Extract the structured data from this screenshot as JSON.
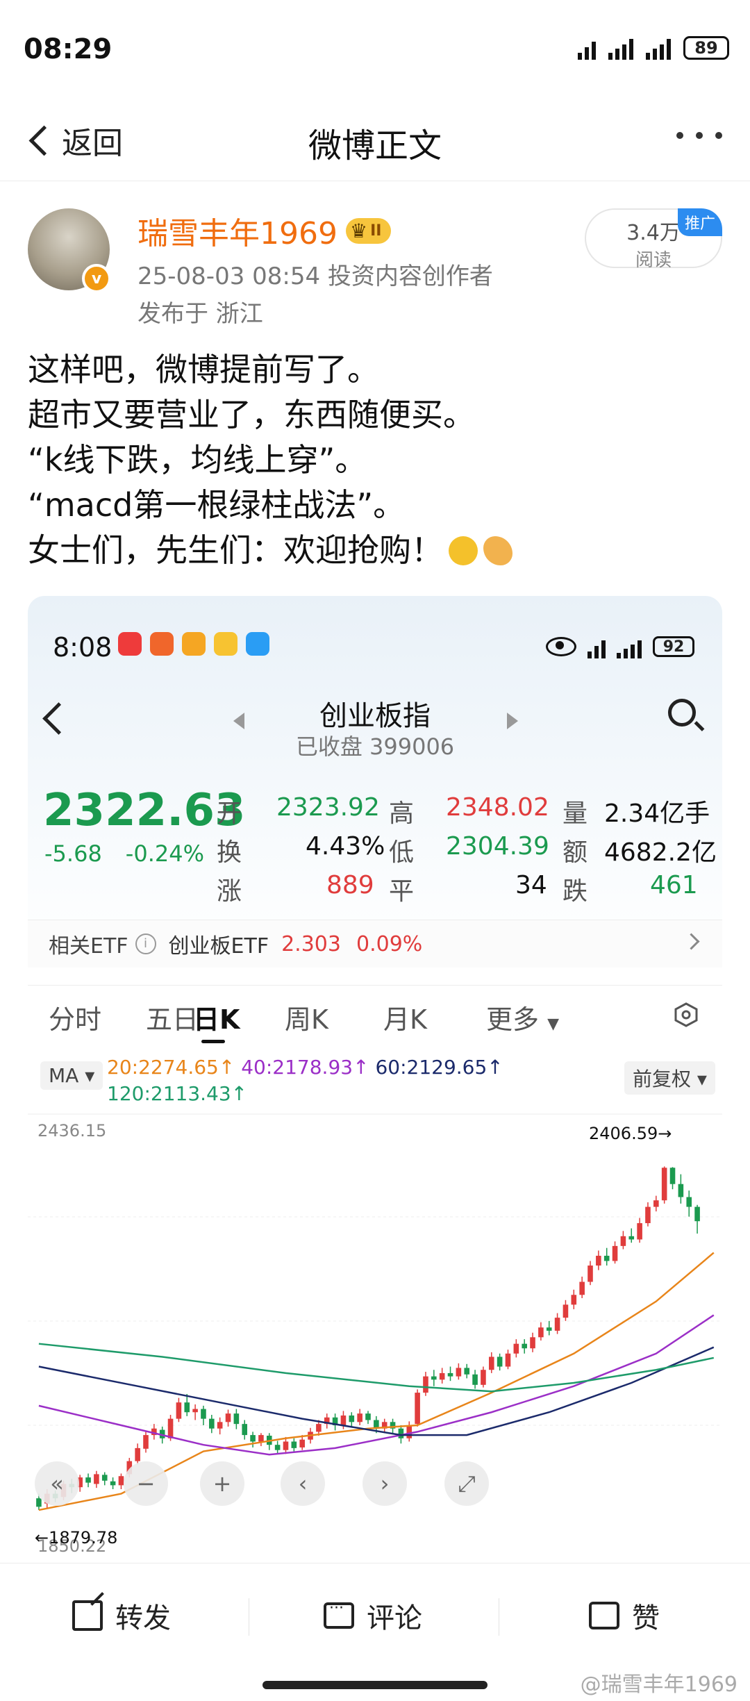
{
  "status_bar": {
    "time": "08:29",
    "signal1": "6",
    "signal2": "5A",
    "signal3": "5A",
    "battery": "89"
  },
  "nav": {
    "back_label": "返回",
    "title": "微博正文"
  },
  "author": {
    "name": "瑞雪丰年1969",
    "level_badge": "II",
    "meta": "25-08-03 08:54  投资内容创作者",
    "location": "发布于 浙江",
    "reads_count": "3.4万",
    "reads_label": "阅读",
    "promo_tag": "推广"
  },
  "post": {
    "lines": [
      "这样吧，微博提前写了。",
      "超市又要营业了，东西随便买。",
      "“k线下跌，均线上穿”。",
      "“macd第一根绿柱战法”。",
      "女士们，先生们：欢迎抢购！"
    ]
  },
  "screenshot": {
    "status": {
      "time": "8:08",
      "battery": "92"
    },
    "title": "创业板指",
    "subtitle": "已收盘 399006",
    "price": "2322.63",
    "change": "-5.68",
    "change_pct": "-0.24%",
    "stats": {
      "open_label": "开",
      "open": "2323.92",
      "high_label": "高",
      "high": "2348.02",
      "volume_label": "量",
      "volume": "2.34亿手",
      "turnover_label": "换",
      "turnover": "4.43%",
      "low_label": "低",
      "low": "2304.39",
      "amount_label": "额",
      "amount": "4682.2亿",
      "up_label": "涨",
      "up": "889",
      "flat_label": "平",
      "flat": "34",
      "down_label": "跌",
      "down": "461"
    },
    "etf": {
      "label": "相关ETF",
      "name": "创业板ETF",
      "price": "2.303",
      "pct": "0.09%"
    },
    "tabs": [
      "分时",
      "五日",
      "日K",
      "周K",
      "月K",
      "更多"
    ],
    "active_tab": "日K",
    "ma": {
      "btn": "MA",
      "ma20": "20:2274.65↑",
      "ma40": "40:2178.93↑",
      "ma60": "60:2129.65↑",
      "ma120": "120:2113.43↑",
      "adjust": "前复权"
    },
    "colors": {
      "up": "#e03c3c",
      "down": "#1b9a4f",
      "ma20": "#e8851a",
      "ma40": "#9b2fc7",
      "ma60": "#1b2a6b",
      "ma120": "#1e9b6a"
    }
  },
  "chart_data": {
    "type": "candlestick",
    "y_top_label": "2436.15",
    "y_bottom_label": "1850.22",
    "max_marker": "2406.59",
    "min_marker": "1879.78",
    "ylim": [
      1850.22,
      2436.15
    ],
    "candles": [
      [
        1898,
        1885,
        1905,
        1880
      ],
      [
        1890,
        1905,
        1912,
        1882
      ],
      [
        1905,
        1898,
        1910,
        1892
      ],
      [
        1900,
        1920,
        1925,
        1895
      ],
      [
        1920,
        1915,
        1928,
        1906
      ],
      [
        1915,
        1930,
        1934,
        1908
      ],
      [
        1930,
        1922,
        1936,
        1915
      ],
      [
        1920,
        1935,
        1940,
        1914
      ],
      [
        1934,
        1925,
        1938,
        1918
      ],
      [
        1924,
        1918,
        1930,
        1912
      ],
      [
        1918,
        1932,
        1936,
        1912
      ],
      [
        1935,
        1955,
        1960,
        1930
      ],
      [
        1955,
        1975,
        1982,
        1950
      ],
      [
        1974,
        1995,
        2002,
        1968
      ],
      [
        1995,
        2005,
        2012,
        1988
      ],
      [
        2003,
        1990,
        2008,
        1982
      ],
      [
        1990,
        2020,
        2026,
        1986
      ],
      [
        2020,
        2045,
        2052,
        2015
      ],
      [
        2045,
        2030,
        2058,
        2024
      ],
      [
        2030,
        2035,
        2042,
        2018
      ],
      [
        2035,
        2020,
        2040,
        2010
      ],
      [
        2020,
        2005,
        2026,
        1998
      ],
      [
        2005,
        2015,
        2022,
        1996
      ],
      [
        2015,
        2028,
        2034,
        2008
      ],
      [
        2028,
        2012,
        2035,
        2004
      ],
      [
        2012,
        1995,
        2018,
        1988
      ],
      [
        1995,
        1985,
        2000,
        1976
      ],
      [
        1985,
        1995,
        1998,
        1978
      ],
      [
        1994,
        1980,
        1998,
        1972
      ],
      [
        1980,
        1972,
        1986,
        1966
      ],
      [
        1972,
        1985,
        1992,
        1966
      ],
      [
        1985,
        1975,
        1990,
        1970
      ],
      [
        1976,
        1988,
        1995,
        1972
      ],
      [
        1988,
        2000,
        2006,
        1982
      ],
      [
        2000,
        2012,
        2018,
        1994
      ],
      [
        2012,
        2022,
        2028,
        2005
      ],
      [
        2022,
        2010,
        2028,
        2002
      ],
      [
        2010,
        2025,
        2032,
        2004
      ],
      [
        2025,
        2015,
        2030,
        2008
      ],
      [
        2015,
        2028,
        2035,
        2010
      ],
      [
        2028,
        2018,
        2032,
        2012
      ],
      [
        2018,
        2005,
        2024,
        1998
      ],
      [
        2005,
        2015,
        2020,
        1998
      ],
      [
        2015,
        2005,
        2020,
        1996
      ],
      [
        2005,
        1990,
        2010,
        1982
      ],
      [
        1990,
        2010,
        2016,
        1985
      ],
      [
        2012,
        2060,
        2065,
        2008
      ],
      [
        2060,
        2085,
        2092,
        2055
      ],
      [
        2085,
        2080,
        2095,
        2070
      ],
      [
        2080,
        2090,
        2098,
        2074
      ],
      [
        2090,
        2085,
        2100,
        2078
      ],
      [
        2085,
        2098,
        2105,
        2080
      ],
      [
        2098,
        2088,
        2104,
        2082
      ],
      [
        2088,
        2072,
        2095,
        2066
      ],
      [
        2072,
        2095,
        2100,
        2068
      ],
      [
        2095,
        2115,
        2122,
        2090
      ],
      [
        2115,
        2100,
        2120,
        2094
      ],
      [
        2100,
        2120,
        2126,
        2096
      ],
      [
        2120,
        2135,
        2142,
        2114
      ],
      [
        2135,
        2128,
        2142,
        2120
      ],
      [
        2128,
        2145,
        2152,
        2122
      ],
      [
        2145,
        2160,
        2168,
        2140
      ],
      [
        2160,
        2155,
        2170,
        2148
      ],
      [
        2155,
        2175,
        2182,
        2150
      ],
      [
        2175,
        2195,
        2202,
        2170
      ],
      [
        2195,
        2210,
        2218,
        2188
      ],
      [
        2210,
        2230,
        2238,
        2205
      ],
      [
        2230,
        2255,
        2262,
        2225
      ],
      [
        2255,
        2270,
        2278,
        2248
      ],
      [
        2270,
        2262,
        2282,
        2255
      ],
      [
        2262,
        2285,
        2292,
        2258
      ],
      [
        2285,
        2300,
        2308,
        2280
      ],
      [
        2300,
        2295,
        2312,
        2290
      ],
      [
        2295,
        2320,
        2328,
        2290
      ],
      [
        2320,
        2345,
        2352,
        2315
      ],
      [
        2345,
        2355,
        2362,
        2338
      ],
      [
        2355,
        2405,
        2407,
        2350
      ],
      [
        2405,
        2380,
        2406,
        2372
      ],
      [
        2380,
        2360,
        2395,
        2350
      ],
      [
        2360,
        2345,
        2370,
        2330
      ],
      [
        2345,
        2323,
        2348,
        2304
      ]
    ],
    "ma_lines": {
      "ma20": [
        [
          0,
          1880
        ],
        [
          10,
          1905
        ],
        [
          20,
          1970
        ],
        [
          30,
          1990
        ],
        [
          40,
          2005
        ],
        [
          46,
          2010
        ],
        [
          55,
          2060
        ],
        [
          65,
          2120
        ],
        [
          75,
          2200
        ],
        [
          82,
          2274.65
        ]
      ],
      "ma40": [
        [
          0,
          2040
        ],
        [
          10,
          2010
        ],
        [
          20,
          1980
        ],
        [
          28,
          1965
        ],
        [
          36,
          1975
        ],
        [
          46,
          2000
        ],
        [
          55,
          2030
        ],
        [
          65,
          2070
        ],
        [
          75,
          2120
        ],
        [
          82,
          2178.93
        ]
      ],
      "ma60": [
        [
          0,
          2100
        ],
        [
          12,
          2070
        ],
        [
          22,
          2045
        ],
        [
          32,
          2020
        ],
        [
          44,
          1995
        ],
        [
          52,
          1995
        ],
        [
          62,
          2030
        ],
        [
          72,
          2075
        ],
        [
          82,
          2129.65
        ]
      ],
      "ma120": [
        [
          0,
          2135
        ],
        [
          15,
          2115
        ],
        [
          30,
          2090
        ],
        [
          45,
          2070
        ],
        [
          55,
          2062
        ],
        [
          65,
          2075
        ],
        [
          75,
          2095
        ],
        [
          82,
          2113.43
        ]
      ]
    }
  },
  "bottom": {
    "repost": "转发",
    "comment": "评论",
    "like": "赞"
  },
  "watermark": "@瑞雪丰年1969"
}
